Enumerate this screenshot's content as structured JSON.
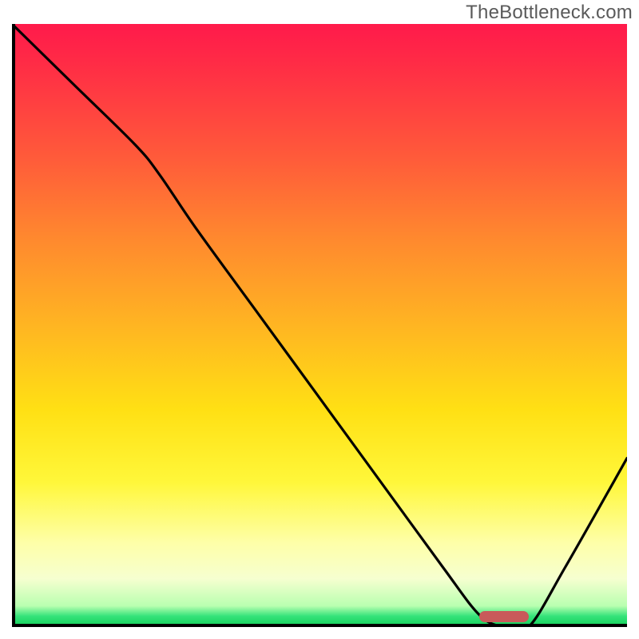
{
  "watermark": "TheBottleneck.com",
  "chart_data": {
    "type": "line",
    "title": "",
    "xlabel": "",
    "ylabel": "",
    "xlim": [
      0,
      100
    ],
    "ylim": [
      0,
      100
    ],
    "gradient_stops": [
      {
        "pct": 0,
        "color": "#ff1a4b"
      },
      {
        "pct": 22,
        "color": "#ff5a3a"
      },
      {
        "pct": 50,
        "color": "#ffb522"
      },
      {
        "pct": 76,
        "color": "#fff73a"
      },
      {
        "pct": 92,
        "color": "#f6ffd0"
      },
      {
        "pct": 98,
        "color": "#35e37a"
      },
      {
        "pct": 100,
        "color": "#11cf58"
      }
    ],
    "series": [
      {
        "name": "bottleneck-curve",
        "x": [
          0,
          10,
          20,
          24,
          30,
          40,
          50,
          60,
          70,
          76,
          80,
          84,
          90,
          100
        ],
        "y": [
          100,
          90,
          80,
          75,
          66,
          52,
          38,
          24,
          10,
          2,
          0,
          0,
          10,
          28
        ]
      }
    ],
    "marker": {
      "name": "optimal-range",
      "x_start": 76,
      "x_end": 84,
      "y": 0,
      "color": "#c95a5a"
    }
  }
}
